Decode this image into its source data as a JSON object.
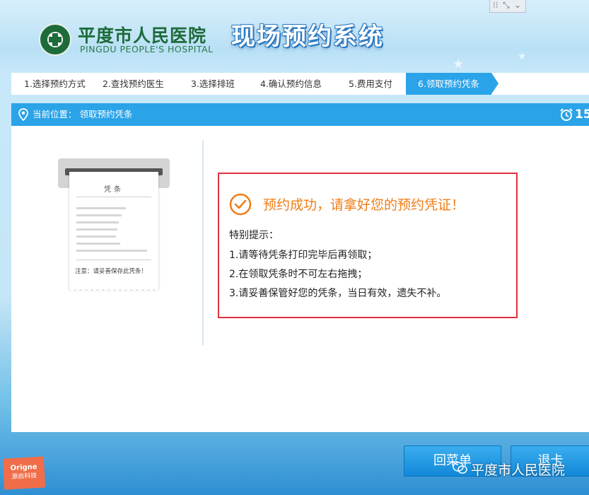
{
  "header": {
    "hospital_cn": "平度市人民医院",
    "hospital_en": "PINGDU PEOPLE'S HOSPITAL",
    "system_title": "现场预约系统"
  },
  "steps": [
    {
      "label": "1.选择预约方式",
      "active": false
    },
    {
      "label": "2.查找预约医生",
      "active": false
    },
    {
      "label": "3.选择排班",
      "active": false
    },
    {
      "label": "4.确认预约信息",
      "active": false
    },
    {
      "label": "5.费用支付",
      "active": false
    },
    {
      "label": "6.领取预约凭条",
      "active": true
    }
  ],
  "location": {
    "label": "当前位置： 领取预约凭条",
    "countdown": "15"
  },
  "receipt": {
    "title": "凭条",
    "note": "注意：请妥善保存此凭条！"
  },
  "message": {
    "success": "预约成功，请拿好您的预约凭证！",
    "tips_heading": "特别提示：",
    "tips": [
      "1.请等待凭条打印完毕后再领取；",
      "2.在领取凭条时不可左右拖拽；",
      "3.请妥善保管好您的凭条，当日有效，遗失不补。"
    ]
  },
  "buttons": {
    "menu": "回菜单",
    "exit": "退卡"
  },
  "watermark": {
    "tag_line1": "Origne",
    "tag_line2": "源启科技",
    "account": "平度市人民医院"
  },
  "colors": {
    "accent": "#2aa3e8",
    "success": "#f07d16",
    "alert_border": "#e0313b",
    "brand_green": "#1e6b3a"
  }
}
